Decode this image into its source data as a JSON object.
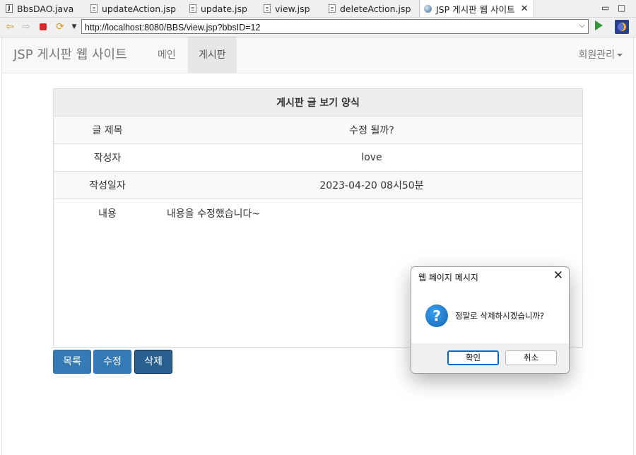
{
  "ide_tabs": [
    {
      "label": "BbsDAO.java",
      "icon": "java-file-icon"
    },
    {
      "label": "updateAction.jsp",
      "icon": "jsp-file-icon"
    },
    {
      "label": "update.jsp",
      "icon": "jsp-file-icon"
    },
    {
      "label": "view.jsp",
      "icon": "jsp-file-icon"
    },
    {
      "label": "deleteAction.jsp",
      "icon": "jsp-file-icon"
    },
    {
      "label": "JSP 게시판 웹 사이트",
      "icon": "globe-icon",
      "active": true
    }
  ],
  "window_controls": {
    "minimize": "▭",
    "maximize": "□"
  },
  "toolbar": {
    "url": "http://localhost:8080/BBS/view.jsp?bbsID=12",
    "icons": [
      "back-arrow-icon",
      "forward-arrow-icon",
      "stop-icon",
      "refresh-icon",
      "menu-dropdown-icon",
      "go-icon",
      "eclipse-icon"
    ]
  },
  "navbar": {
    "brand": "JSP 게시판 웹 사이트",
    "links": [
      {
        "label": "메인"
      },
      {
        "label": "게시판",
        "active": true
      }
    ],
    "dropdown": "회원관리"
  },
  "post_table": {
    "header": "게시판 글 보기 양식",
    "rows": [
      {
        "label": "글 제목",
        "value": "수정 될까?"
      },
      {
        "label": "작성자",
        "value": "love"
      },
      {
        "label": "작성일자",
        "value": "2023-04-20 08시50분"
      },
      {
        "label": "내용",
        "value": "내용을 수정했습니다~"
      }
    ]
  },
  "buttons": {
    "list": "목록",
    "edit": "수정",
    "delete": "삭제"
  },
  "dialog": {
    "title": "웹 페이지 메시지",
    "message": "정말로 삭제하시겠습니까?",
    "ok": "확인",
    "cancel": "취소",
    "icon": "question-icon"
  },
  "colors": {
    "primary": "#337ab7",
    "primary_pressed": "#286090",
    "navbar_bg": "#f8f8f8",
    "dialog_accent": "#0067c0"
  }
}
